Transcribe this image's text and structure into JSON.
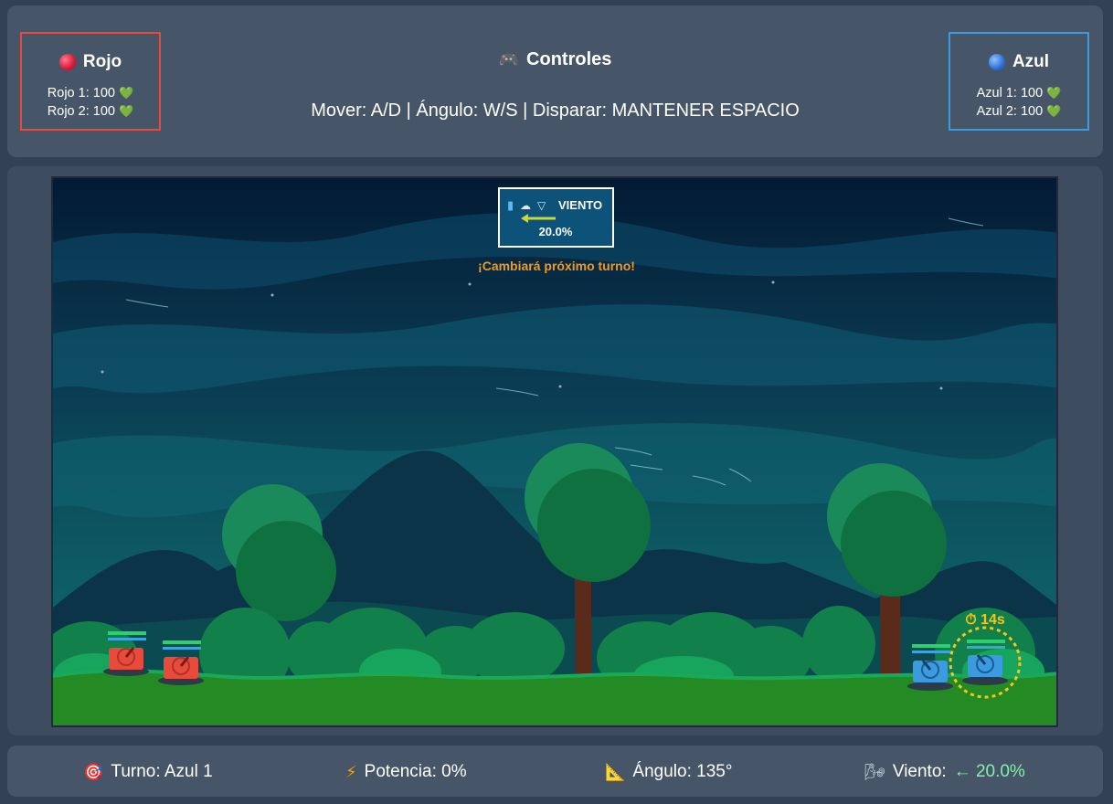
{
  "teams": {
    "red": {
      "name": "Rojo",
      "units": [
        {
          "label": "Rojo 1: 100"
        },
        {
          "label": "Rojo 2: 100"
        }
      ],
      "color": "#e84a3c"
    },
    "blue": {
      "name": "Azul",
      "units": [
        {
          "label": "Azul 1: 100"
        },
        {
          "label": "Azul 2: 100"
        }
      ],
      "color": "#3b9ae0"
    }
  },
  "controls": {
    "title": "Controles",
    "text": "Mover: A/D | Ángulo: W/S | Disparar: MANTENER ESPACIO"
  },
  "wind_box": {
    "label": "VIENTO",
    "value": "20.0%",
    "direction": "left",
    "notice": "¡Cambiará próximo turno!"
  },
  "timer": {
    "label": "⏱ 14s"
  },
  "status": {
    "turn_label": "Turno: Azul 1",
    "power_label": "Potencia: 0%",
    "angle_label": "Ángulo: 135°",
    "wind_label": "Viento:",
    "wind_value": "← 20.0%"
  },
  "icons": {
    "red_team": "red-circle-icon",
    "blue_team": "blue-circle-icon",
    "controls": "gamepad-icon",
    "turn": "target-icon",
    "power": "lightning-icon",
    "angle": "triangle-ruler-icon",
    "wind": "wind-icon"
  }
}
